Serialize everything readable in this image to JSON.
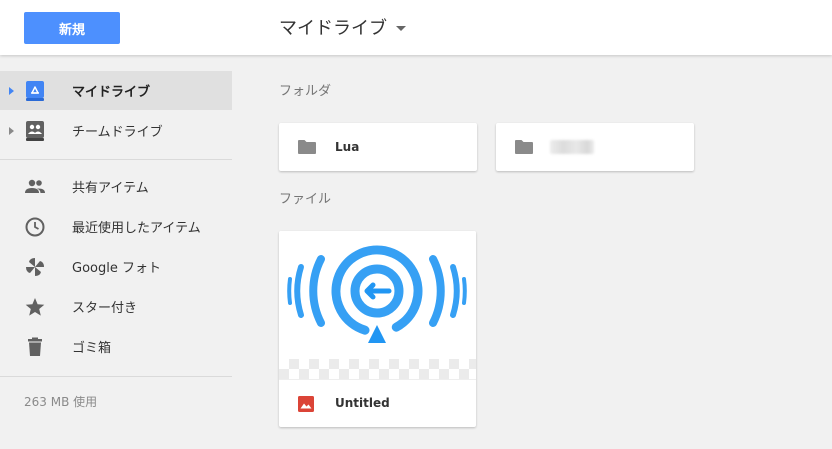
{
  "header": {
    "new_button_label": "新規",
    "drive_title": "マイドライブ"
  },
  "sidebar": {
    "items": [
      {
        "label": "マイドライブ",
        "icon": "my-drive-icon",
        "selected": true,
        "has_arrow": true
      },
      {
        "label": "チームドライブ",
        "icon": "team-drive-icon",
        "selected": false,
        "has_arrow": true
      },
      {
        "label": "共有アイテム",
        "icon": "shared-icon",
        "selected": false,
        "has_arrow": false
      },
      {
        "label": "最近使用したアイテム",
        "icon": "clock-icon",
        "selected": false,
        "has_arrow": false
      },
      {
        "label": "Google フォト",
        "icon": "photos-pinwheel-icon",
        "selected": false,
        "has_arrow": false
      },
      {
        "label": "スター付き",
        "icon": "star-icon",
        "selected": false,
        "has_arrow": false
      },
      {
        "label": "ゴミ箱",
        "icon": "trash-icon",
        "selected": false,
        "has_arrow": false
      }
    ],
    "storage_text": "263 MB 使用"
  },
  "main": {
    "folders_heading": "フォルダ",
    "folders": [
      {
        "name": "Lua",
        "icon": "folder-icon"
      },
      {
        "name": "",
        "icon": "folder-icon",
        "name_blurred": true
      }
    ],
    "files_heading": "ファイル",
    "files": [
      {
        "name": "Untitled",
        "icon": "image-file-icon"
      }
    ]
  },
  "colors": {
    "accent": "#4d90fe",
    "selected_bg": "#e0e0e0",
    "thumbnail_blue": "#2196f3",
    "image_icon_red": "#db4437"
  }
}
